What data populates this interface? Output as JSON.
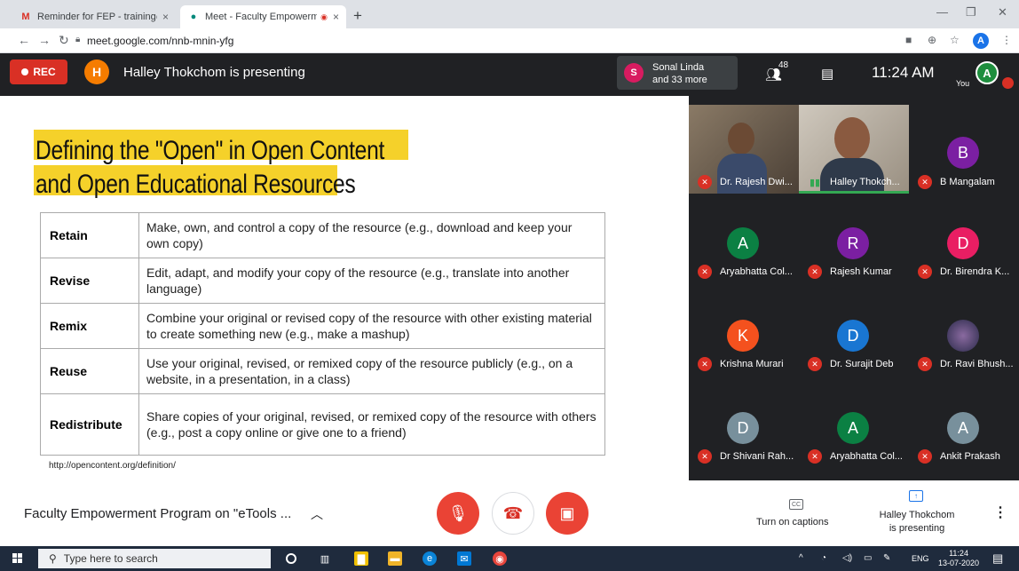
{
  "browser": {
    "tabs": [
      {
        "title": "Reminder for FEP - training@ary",
        "icon": "gmail-icon"
      },
      {
        "title": "Meet - Faculty Empowermen",
        "icon": "meet-icon"
      }
    ],
    "url": "meet.google.com/nnb-mnin-yfg",
    "profile_initial": "A"
  },
  "meet_header": {
    "rec_label": "REC",
    "presenter_initial": "H",
    "presenting_text": "Halley Thokchom is presenting",
    "others_initial": "S",
    "others_line1": "Sonal Linda",
    "others_line2": "and 33 more",
    "participant_count": "48",
    "time": "11:24 AM",
    "you_label": "You",
    "you_initial": "A"
  },
  "slide": {
    "title_line1": "Defining the \"Open\" in Open Content",
    "title_line2": "and Open Educational Resources",
    "rows": [
      {
        "term": "Retain",
        "definition": "Make, own, and control a copy of the resource (e.g., download and keep your own copy)"
      },
      {
        "term": "Revise",
        "definition": "Edit, adapt, and modify your copy of the resource (e.g., translate into another language)"
      },
      {
        "term": "Remix",
        "definition": "Combine your original or revised copy of the resource with other existing material to create something new (e.g., make a mashup)"
      },
      {
        "term": "Reuse",
        "definition": "Use your original, revised, or remixed copy of the resource publicly (e.g., on a website, in a presentation, in a class)"
      },
      {
        "term": "Redistribute",
        "definition": "Share copies of your original, revised, or remixed copy of the resource with others (e.g., post a copy online or give one to a friend)"
      }
    ],
    "source": "http://opencontent.org/definition/"
  },
  "participants": [
    {
      "name": "Dr. Rajesh Dwi...",
      "initial": "",
      "color": "",
      "video": true
    },
    {
      "name": "Halley Thokch...",
      "initial": "",
      "color": "",
      "video": true
    },
    {
      "name": "B Mangalam",
      "initial": "B",
      "color": "#7b1fa2"
    },
    {
      "name": "Aryabhatta Col...",
      "initial": "A",
      "color": "#0b8043"
    },
    {
      "name": "Rajesh Kumar",
      "initial": "R",
      "color": "#7b1fa2"
    },
    {
      "name": "Dr. Birendra K...",
      "initial": "D",
      "color": "#e91e63"
    },
    {
      "name": "Krishna Murari",
      "initial": "K",
      "color": "#f4511e"
    },
    {
      "name": "Dr. Surajit Deb",
      "initial": "D",
      "color": "#1976d2"
    },
    {
      "name": "Dr. Ravi Bhush...",
      "initial": "",
      "color": "#4a4a6a",
      "photo": true
    },
    {
      "name": "Dr Shivani Rah...",
      "initial": "D",
      "color": "#78909c"
    },
    {
      "name": "Aryabhatta Col...",
      "initial": "A",
      "color": "#0b8043"
    },
    {
      "name": "Ankit Prakash",
      "initial": "A",
      "color": "#78909c"
    }
  ],
  "bottom": {
    "meeting_title": "Faculty Empowerment Program on \"eTools ...",
    "captions_label": "Turn on captions",
    "presenting_label": "Halley Thokchom is presenting"
  },
  "taskbar": {
    "search_placeholder": "Type here to search",
    "lang": "ENG",
    "time": "11:24",
    "date": "13-07-2020"
  }
}
